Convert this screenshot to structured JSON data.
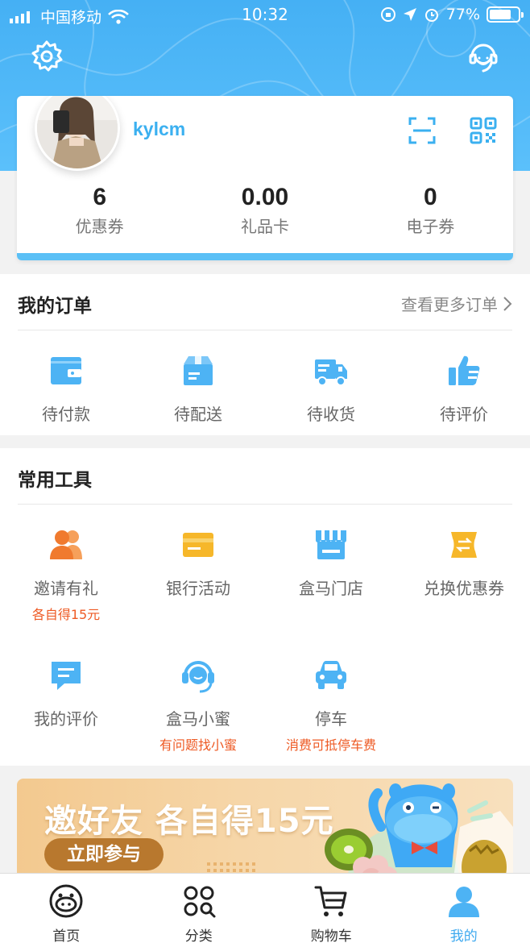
{
  "status_bar": {
    "carrier": "中国移动",
    "time": "10:32",
    "battery_text": "77%",
    "battery_level": 0.77
  },
  "profile": {
    "username": "kylcm",
    "stats": [
      {
        "value": "6",
        "label": "优惠券"
      },
      {
        "value": "0.00",
        "label": "礼品卡"
      },
      {
        "value": "0",
        "label": "电子券"
      }
    ]
  },
  "orders": {
    "title": "我的订单",
    "more_label": "查看更多订单",
    "items": [
      {
        "label": "待付款",
        "icon": "wallet-icon"
      },
      {
        "label": "待配送",
        "icon": "package-icon"
      },
      {
        "label": "待收货",
        "icon": "truck-icon"
      },
      {
        "label": "待评价",
        "icon": "thumbs-up-icon"
      }
    ]
  },
  "tools": {
    "title": "常用工具",
    "items": [
      {
        "label": "邀请有礼",
        "sub": "各自得15元",
        "icon": "invite-users-icon"
      },
      {
        "label": "银行活动",
        "sub": "",
        "icon": "bank-card-icon"
      },
      {
        "label": "盒马门店",
        "sub": "",
        "icon": "store-icon"
      },
      {
        "label": "兑换优惠券",
        "sub": "",
        "icon": "coupon-exchange-icon"
      },
      {
        "label": "我的评价",
        "sub": "",
        "icon": "comment-icon"
      },
      {
        "label": "盒马小蜜",
        "sub": "有问题找小蜜",
        "icon": "headset-icon"
      },
      {
        "label": "停车",
        "sub": "消费可抵停车费",
        "icon": "car-icon"
      }
    ]
  },
  "banner": {
    "title": "邀好友 各自得15元",
    "button_label": "立即参与"
  },
  "tabbar": {
    "items": [
      {
        "label": "首页",
        "icon": "hippo-home-icon",
        "active": false
      },
      {
        "label": "分类",
        "icon": "category-icon",
        "active": false
      },
      {
        "label": "购物车",
        "icon": "cart-icon",
        "active": false
      },
      {
        "label": "我的",
        "icon": "profile-icon",
        "active": true
      }
    ]
  },
  "colors": {
    "header_blue": "#4fb8f7",
    "icon_blue": "#4db3f4",
    "accent_orange": "#ee5a24",
    "icon_orange": "#f07a2e",
    "icon_yellow": "#f6b72a"
  }
}
